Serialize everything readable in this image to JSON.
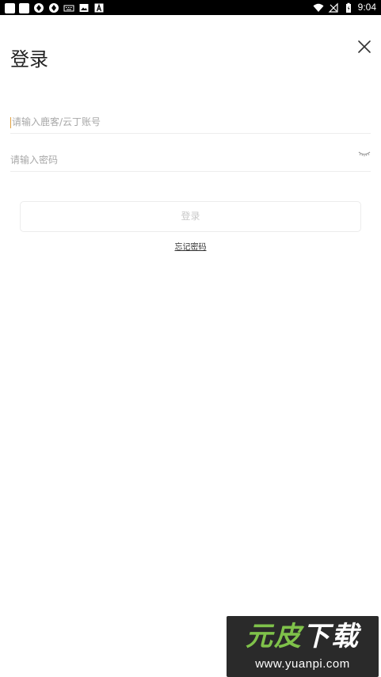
{
  "status_bar": {
    "time": "9:04"
  },
  "header": {
    "title": "登录"
  },
  "form": {
    "account_placeholder": "请输入鹿客/云丁账号",
    "account_value": "",
    "password_placeholder": "请输入密码",
    "password_value": "",
    "login_label": "登录",
    "forgot_label": "忘记密码"
  },
  "watermark": {
    "brand_part1": "元皮",
    "brand_part2": "下载",
    "url": "www.yuanpi.com"
  },
  "colors": {
    "cursor": "#e0a040",
    "watermark_green": "#7fc24a"
  }
}
